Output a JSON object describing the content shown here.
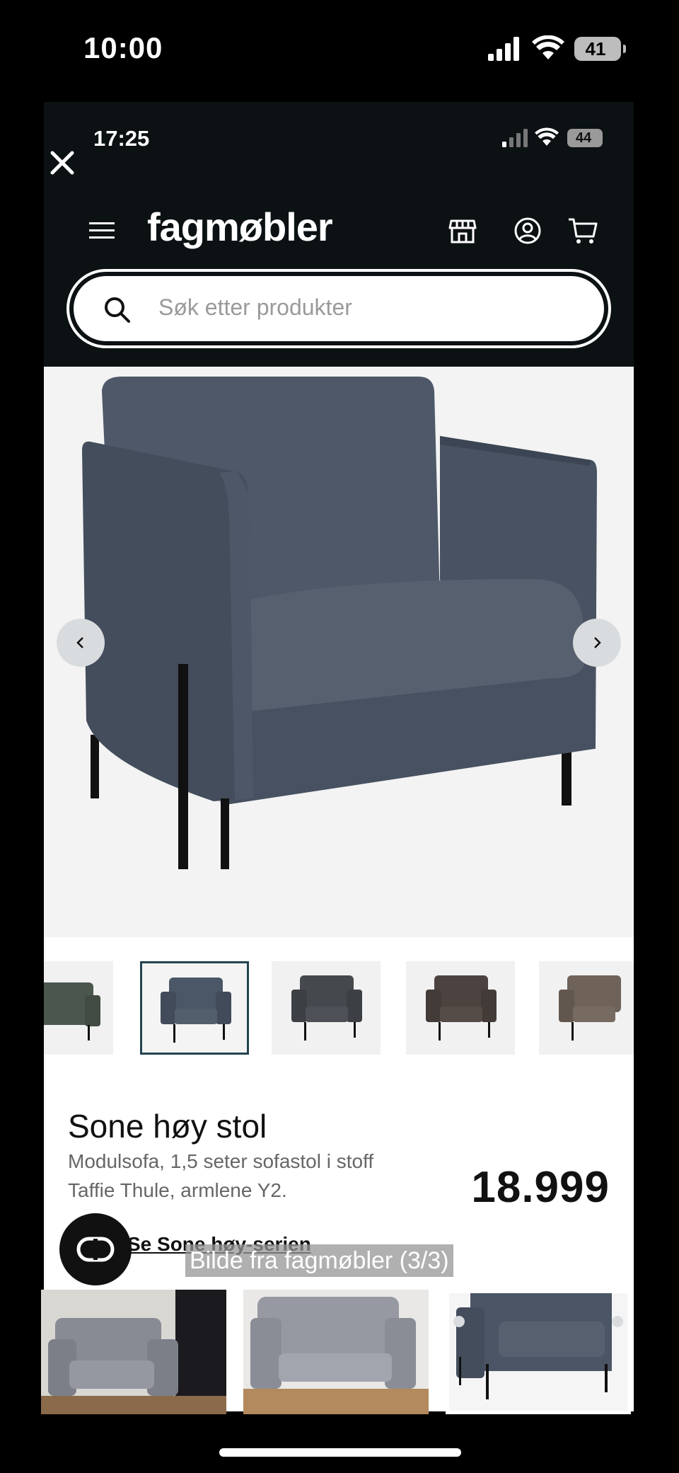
{
  "outer_status": {
    "time": "10:00",
    "battery": "41"
  },
  "inner_status": {
    "time": "17:25",
    "battery": "44"
  },
  "header": {
    "logo": "fagmøbler"
  },
  "search": {
    "placeholder": "Søk etter produkter"
  },
  "product": {
    "title": "Sone høy stol",
    "subtitle": "Modulsofa, 1,5 seter sofastol i stoff Taffie Thule, armlene Y2.",
    "price": "18.999",
    "series_link": "Se Sone høy-serien"
  },
  "thumbnails": [
    {
      "color": "#4b564c"
    },
    {
      "color": "#4b5666"
    },
    {
      "color": "#45484d"
    },
    {
      "color": "#4c4340"
    },
    {
      "color": "#6e6259"
    }
  ],
  "caption": "Bilde fra fagmøbler (3/3)",
  "colors": {
    "header_bg": "#0c1214",
    "chair": "#4b5565",
    "selected_border": "#23444f"
  }
}
